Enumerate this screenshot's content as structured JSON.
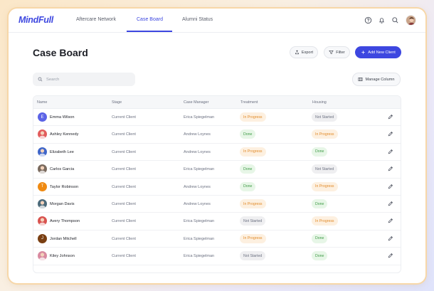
{
  "app": {
    "logo": "MindFull"
  },
  "nav": {
    "tabs": [
      {
        "label": "Aftercare Network",
        "active": false
      },
      {
        "label": "Case Board",
        "active": true
      },
      {
        "label": "Alumni Status",
        "active": false
      }
    ],
    "icons": [
      "help-icon",
      "bell-icon",
      "search-icon",
      "user-avatar"
    ]
  },
  "page": {
    "title": "Case Board"
  },
  "toolbar": {
    "export_label": "Export",
    "filter_label": "Filter",
    "add_label": "Add New Client",
    "search_placeholder": "Search",
    "manage_label": "Manage Column"
  },
  "table": {
    "headers": [
      "Name",
      "Stage",
      "Case Manager",
      "Treatment",
      "Housing"
    ],
    "rows": [
      {
        "name": "Emma Wilson",
        "initial": "E",
        "avatar_color": "#5b63e6",
        "stage": "Current Client",
        "manager": "Erica Spiegelman",
        "treatment": "In Progress",
        "housing": "Not Started"
      },
      {
        "name": "Ashley Kennedy",
        "initial": "",
        "avatar_color": "#e25c5c",
        "stage": "Current Client",
        "manager": "Andrew Loynes",
        "treatment": "Done",
        "housing": "In Progress"
      },
      {
        "name": "Elizabeth Lee",
        "initial": "",
        "avatar_color": "#3f66c9",
        "stage": "Current Client",
        "manager": "Andrew Loynes",
        "treatment": "In Progress",
        "housing": "Done"
      },
      {
        "name": "Carlos Garcia",
        "initial": "",
        "avatar_color": "#7a6a5e",
        "stage": "Current Client",
        "manager": "Erica Spiegelman",
        "treatment": "Done",
        "housing": "Not Started"
      },
      {
        "name": "Taylor Robinson",
        "initial": "T",
        "avatar_color": "#ef8a12",
        "stage": "Current Client",
        "manager": "Andrew Loynes",
        "treatment": "Done",
        "housing": "In Progress"
      },
      {
        "name": "Morgan Davis",
        "initial": "",
        "avatar_color": "#4c6a7a",
        "stage": "Current Client",
        "manager": "Andrew Loynes",
        "treatment": "In Progress",
        "housing": "Done"
      },
      {
        "name": "Avery Thompson",
        "initial": "",
        "avatar_color": "#d9534f",
        "stage": "Current Client",
        "manager": "Erica Spiegelman",
        "treatment": "Not Started",
        "housing": "In Progress"
      },
      {
        "name": "Jordan Mitchell",
        "initial": "J",
        "avatar_color": "#7a3f12",
        "stage": "Current Client",
        "manager": "Erica Spiegelman",
        "treatment": "In Progress",
        "housing": "Done"
      },
      {
        "name": "Kiley Johnson",
        "initial": "",
        "avatar_color": "#d98aa0",
        "stage": "Current Client",
        "manager": "Erica Spiegelman",
        "treatment": "Not Started",
        "housing": "Done"
      }
    ]
  },
  "colors": {
    "accent": "#3d47e0",
    "in_progress": "#e18b2a",
    "done": "#3f9b46",
    "not_started": "#6b7080"
  }
}
